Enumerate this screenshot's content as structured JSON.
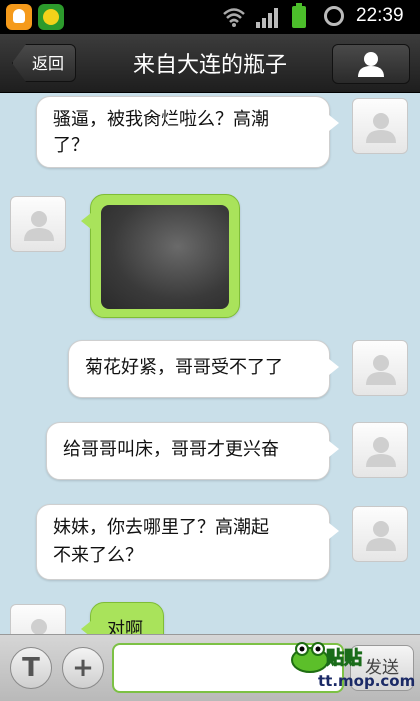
{
  "status_bar": {
    "time": "22:39",
    "icons": [
      "qq-icon",
      "security-app-icon",
      "wifi-icon",
      "signal-icon",
      "battery-icon",
      "alarm-icon"
    ]
  },
  "header": {
    "back_label": "返回",
    "title": "来自大连的瓶子",
    "profile_icon": "user-icon"
  },
  "messages": [
    {
      "side": "out",
      "text_line1": "骚逼，被我肏烂啦么？高潮",
      "text_line2": "了？"
    },
    {
      "side": "in",
      "type": "image"
    },
    {
      "side": "out",
      "text": "菊花好紧，哥哥受不了了"
    },
    {
      "side": "out",
      "text": "给哥哥叫床，哥哥才更兴奋"
    },
    {
      "side": "out",
      "text_line1": "妹妹，你去哪里了？高潮起",
      "text_line2": "不来了么？"
    },
    {
      "side": "in",
      "text": "对啊"
    }
  ],
  "input_bar": {
    "text_mode_label": "T",
    "plus_label": "+",
    "input_value": "",
    "send_label": "发送"
  },
  "watermark": {
    "line1": "贴贴",
    "line2": "tt.mop.com"
  },
  "colors": {
    "chat_background": "#c9dfe9",
    "incoming_bubble": "#a9e35b",
    "outgoing_bubble": "#ffffff",
    "title_bar": "#2a2a2a"
  }
}
